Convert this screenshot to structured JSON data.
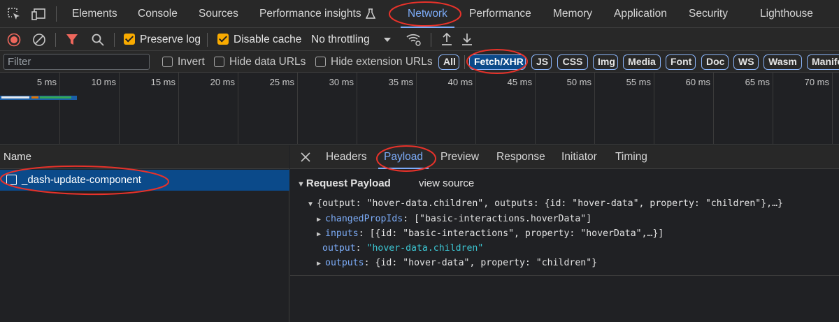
{
  "top_tabs": [
    {
      "label": "Elements"
    },
    {
      "label": "Console"
    },
    {
      "label": "Sources"
    },
    {
      "label": "Performance insights"
    },
    {
      "label": "Network"
    },
    {
      "label": "Performance"
    },
    {
      "label": "Memory"
    },
    {
      "label": "Application"
    },
    {
      "label": "Security"
    },
    {
      "label": "Lighthouse"
    }
  ],
  "active_top_tab": "Network",
  "toolbar": {
    "preserve_log": {
      "label": "Preserve log",
      "checked": true
    },
    "disable_cache": {
      "label": "Disable cache",
      "checked": true
    },
    "throttling": "No throttling"
  },
  "filter_bar": {
    "placeholder": "Filter",
    "invert": "Invert",
    "hide_data_urls": "Hide data URLs",
    "hide_extension_urls": "Hide extension URLs",
    "types": [
      "All",
      "Fetch/XHR",
      "JS",
      "CSS",
      "Img",
      "Media",
      "Font",
      "Doc",
      "WS",
      "Wasm",
      "Manife"
    ],
    "active_type": "Fetch/XHR"
  },
  "timeline": {
    "ticks": [
      "5 ms",
      "10 ms",
      "15 ms",
      "20 ms",
      "25 ms",
      "30 ms",
      "35 ms",
      "40 ms",
      "45 ms",
      "50 ms",
      "55 ms",
      "60 ms",
      "65 ms",
      "70 ms"
    ]
  },
  "request_list": {
    "header": "Name",
    "rows": [
      {
        "name": "_dash-update-component"
      }
    ]
  },
  "detail_tabs": [
    "Headers",
    "Payload",
    "Preview",
    "Response",
    "Initiator",
    "Timing"
  ],
  "active_detail_tab": "Payload",
  "payload": {
    "section_title": "Request Payload",
    "view_source": "view source",
    "summary": "{output: \"hover-data.children\", outputs: {id: \"hover-data\", property: \"children\"},…}",
    "lines": [
      {
        "key": "changedPropIds",
        "value": "[\"basic-interactions.hoverData\"]"
      },
      {
        "key": "inputs",
        "value": "[{id: \"basic-interactions\", property: \"hoverData\",…}]"
      },
      {
        "key": "output",
        "value": "\"hover-data.children\""
      },
      {
        "key": "outputs",
        "value": "{id: \"hover-data\", property: \"children\"}"
      }
    ]
  },
  "colors": {
    "accent": "#7cacf8",
    "selected_row": "#0b4a8a",
    "checkbox": "#f9ab00",
    "annotation": "#e8322a",
    "string_value": "#3cc6d3"
  }
}
